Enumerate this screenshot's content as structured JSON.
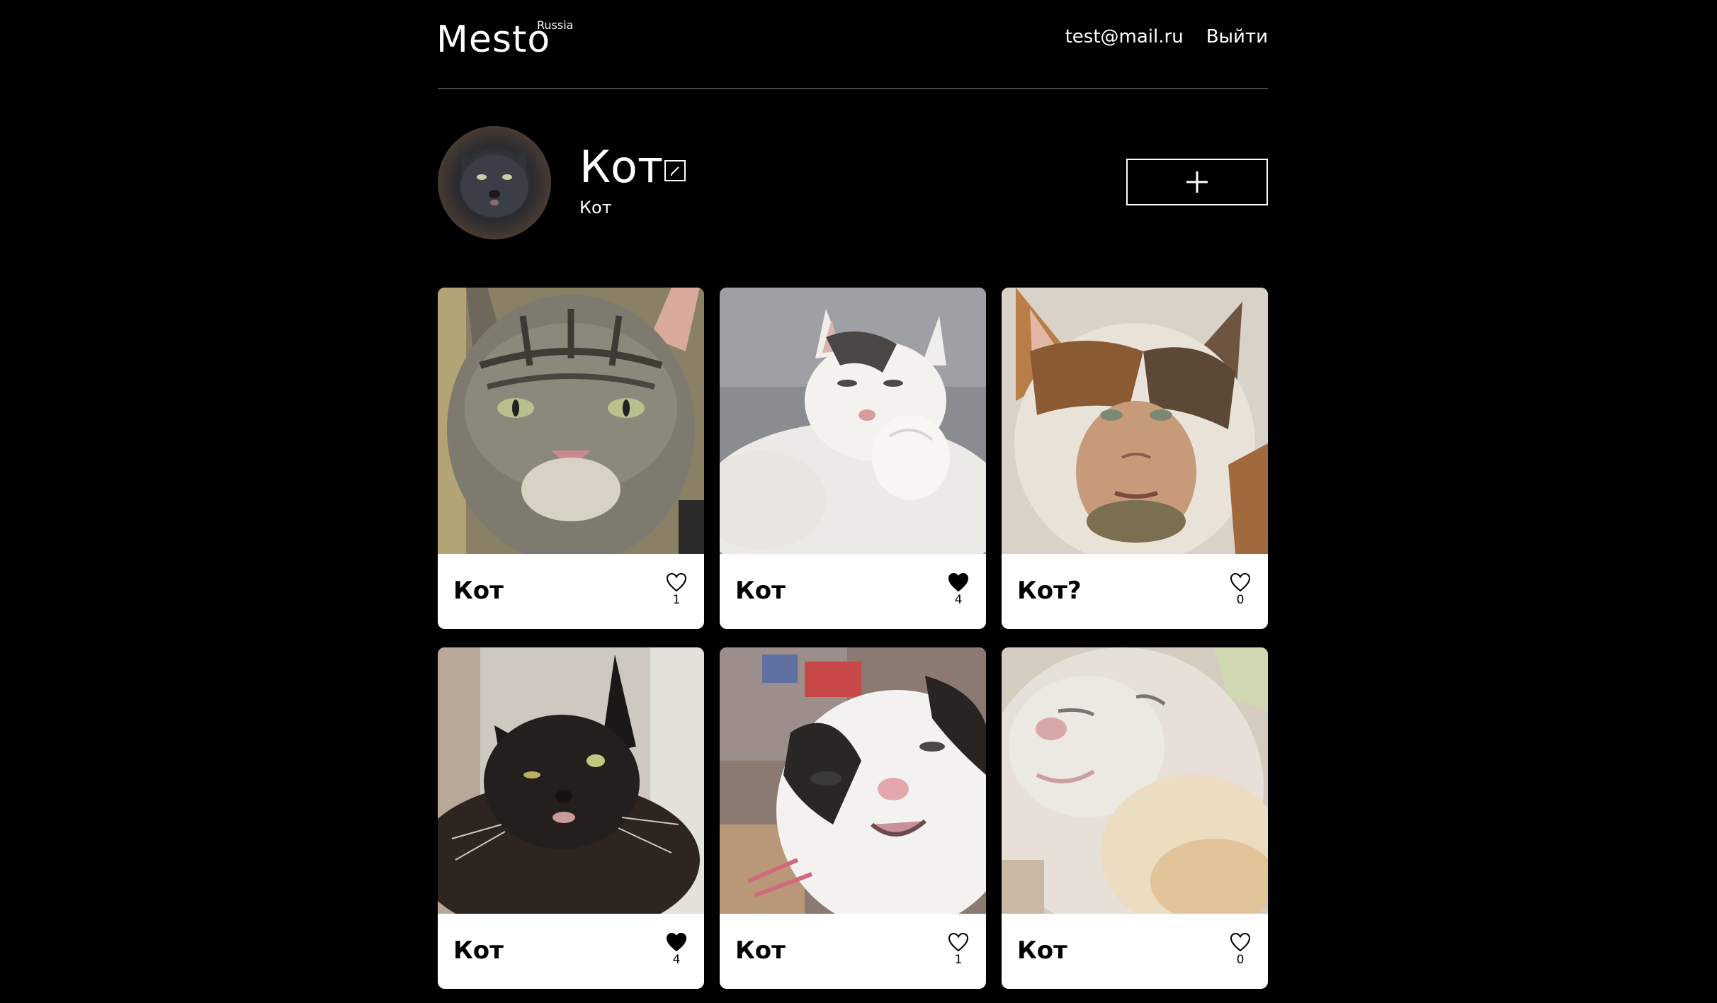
{
  "header": {
    "logo": "Mesto",
    "logo_sup": "Russia",
    "email": "test@mail.ru",
    "logout_label": "Выйти"
  },
  "profile": {
    "name": "Кот",
    "about": "Кот",
    "edit_icon": "pencil-icon",
    "add_icon": "plus-icon"
  },
  "cards": [
    {
      "title": "Кот",
      "likes": "1",
      "liked": false
    },
    {
      "title": "Кот",
      "likes": "4",
      "liked": true
    },
    {
      "title": "Кот?",
      "likes": "0",
      "liked": false
    },
    {
      "title": "Кот",
      "likes": "4",
      "liked": true
    },
    {
      "title": "Кот",
      "likes": "1",
      "liked": false
    },
    {
      "title": "Кот",
      "likes": "0",
      "liked": false
    }
  ],
  "colors": {
    "background": "#000000",
    "card": "#ffffff",
    "text_dark": "#000000",
    "text_light": "#ffffff"
  }
}
